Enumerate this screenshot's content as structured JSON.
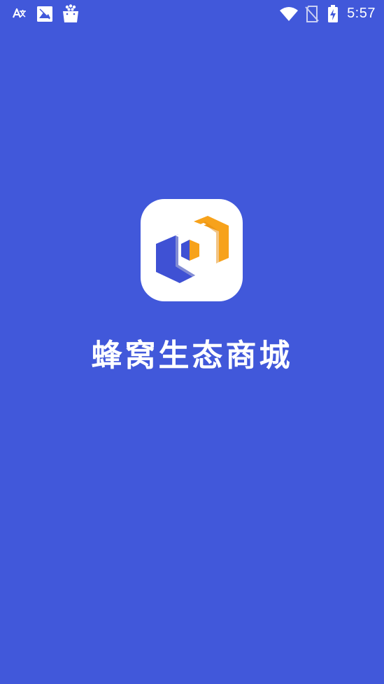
{
  "status_bar": {
    "time": "5:57",
    "left_icons": [
      "translate-icon",
      "image-notification-icon",
      "shopping-bag-icon"
    ],
    "right_icons": [
      "wifi-icon",
      "no-sim-icon",
      "battery-charging-icon"
    ]
  },
  "splash": {
    "app_name": "蜂窝生态商城",
    "logo_icon": "hexagon-cube-logo-icon"
  },
  "colors": {
    "background": "#4158da",
    "logo_blue": "#3f51d4",
    "logo_orange": "#f7a21b",
    "white": "#ffffff"
  }
}
